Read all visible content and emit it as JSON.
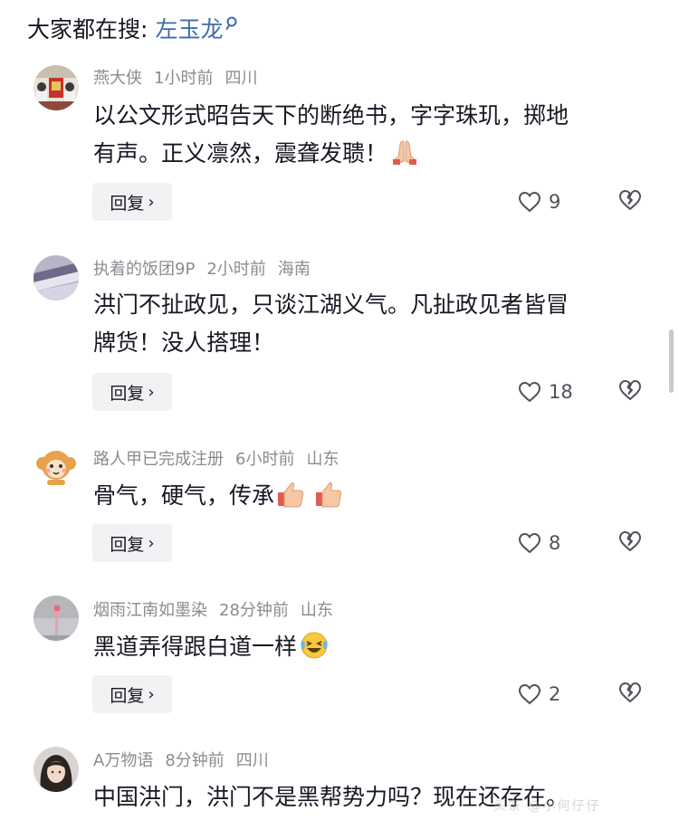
{
  "search": {
    "label": "大家都在搜:",
    "term": "左玉龙"
  },
  "colors": {
    "link": "#3d6ca8",
    "meta": "#8a8b91",
    "text": "#161823",
    "reply_bg": "#f2f2f4"
  },
  "comments": [
    {
      "user": "燕大侠",
      "time": "1小时前",
      "location": "四川",
      "lines": [
        "以公文形式昭告天下的断绝书，字字珠玑，掷地",
        "有声。正义凛然，震聋发聩！"
      ],
      "emoji": "folded-hands",
      "reply_label": "回复",
      "likes": "9"
    },
    {
      "user": "执着的饭团9P",
      "time": "2小时前",
      "location": "海南",
      "lines": [
        "洪门不扯政见，只谈江湖义气。凡扯政见者皆冒",
        "牌货！没人搭理！"
      ],
      "reply_label": "回复",
      "likes": "18"
    },
    {
      "user": "路人甲已完成注册",
      "time": "6小时前",
      "location": "山东",
      "lines": [
        "骨气，硬气，传承"
      ],
      "emoji": "thumbs-up",
      "reply_label": "回复",
      "likes": "8"
    },
    {
      "user": "烟雨江南如墨染",
      "time": "28分钟前",
      "location": "山东",
      "lines": [
        "黑道弄得跟白道一样"
      ],
      "emoji": "laughing-crying",
      "reply_label": "回复",
      "likes": "2"
    },
    {
      "user": "A万物语",
      "time": "8分钟前",
      "location": "四川",
      "lines": [
        "中国洪门，洪门不是黑帮势力吗？现在还存在。"
      ]
    }
  ],
  "watermark": "头条 @小何仔仔"
}
